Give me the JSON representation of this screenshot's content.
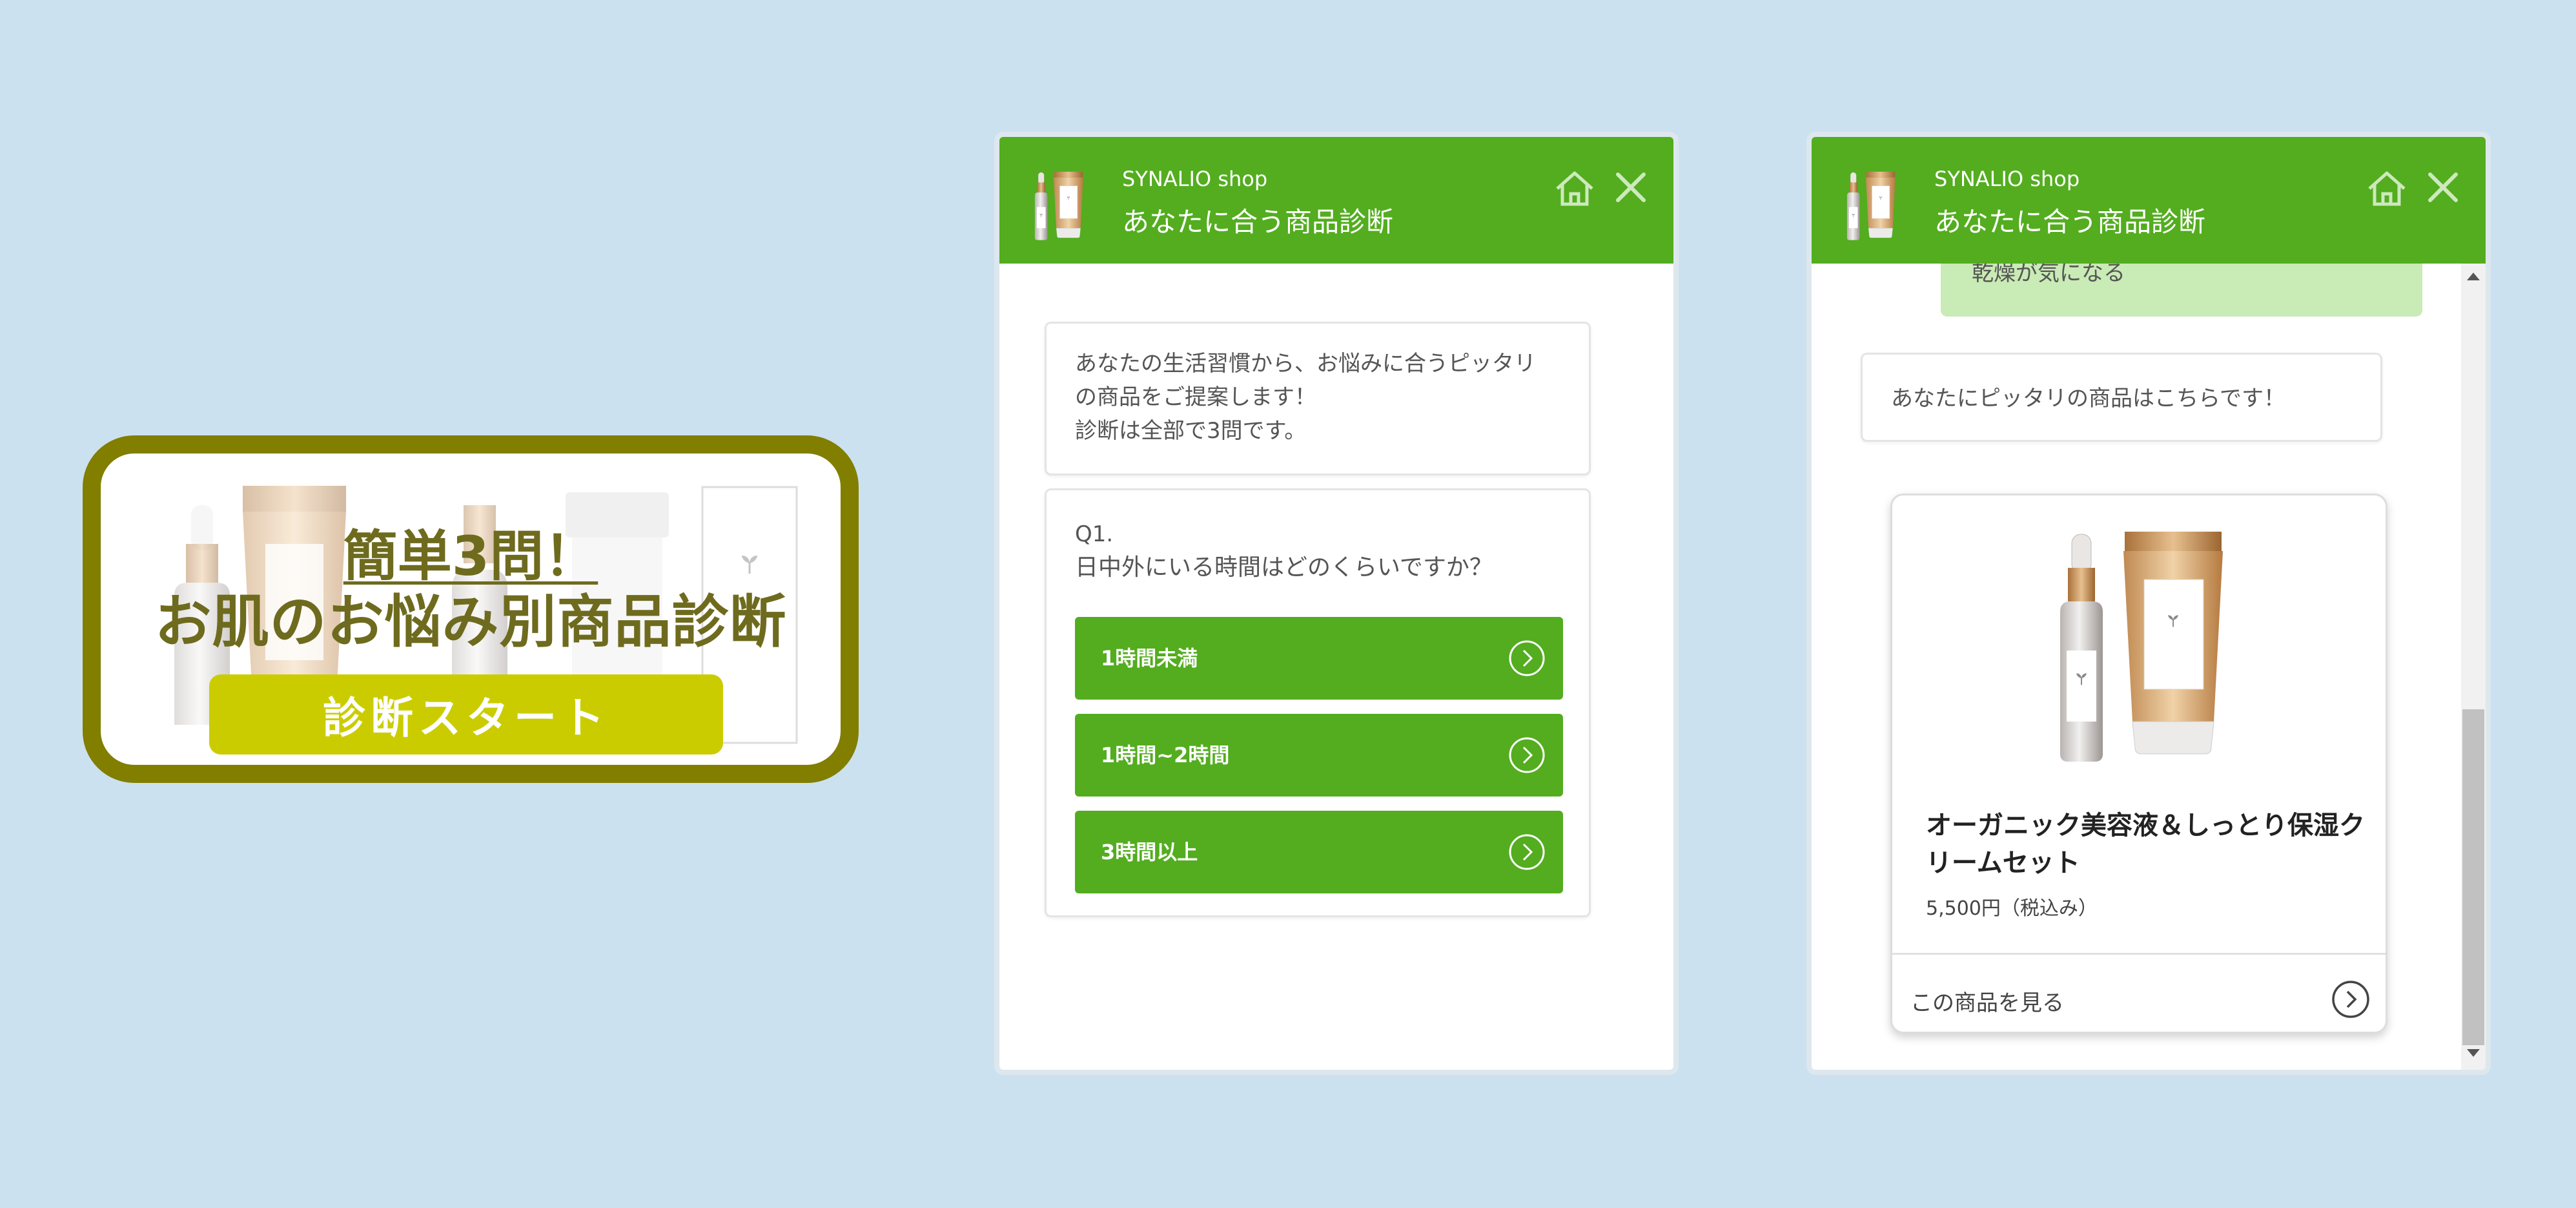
{
  "colors": {
    "background": "#cce1ef",
    "brand_green": "#53ad1f",
    "banner_border": "#817e00",
    "banner_text": "#6e6b1e",
    "banner_button": "#cbcc00",
    "answer_bubble": "#c9ebb5"
  },
  "banner": {
    "title_line1": "簡単3問！",
    "title_line2": "お肌のお悩み別商品診断",
    "start_button": "診断スタート"
  },
  "chat_header": {
    "shop_name": "SYNALIO shop",
    "title": "あなたに合う商品診断",
    "home_icon": "home-icon",
    "close_icon": "close-icon"
  },
  "panel1": {
    "intro_lines": [
      "あなたの生活習慣から、お悩みに合うピッタリ",
      "の商品をご提案します！",
      "診断は全部で3問です。"
    ],
    "question_number": "Q1.",
    "question_text": "日中外にいる時間はどのくらいですか？",
    "options": [
      "1時間未満",
      "1時間~2時間",
      "3時間以上"
    ]
  },
  "panel2": {
    "previous_answer": "乾燥が気になる",
    "result_message": "あなたにピッタリの商品はこちらです！",
    "product": {
      "name": "オーガニック美容液＆しっとり保湿クリームセット",
      "price": "5,500円（税込み）",
      "link_label": "この商品を見る"
    }
  }
}
